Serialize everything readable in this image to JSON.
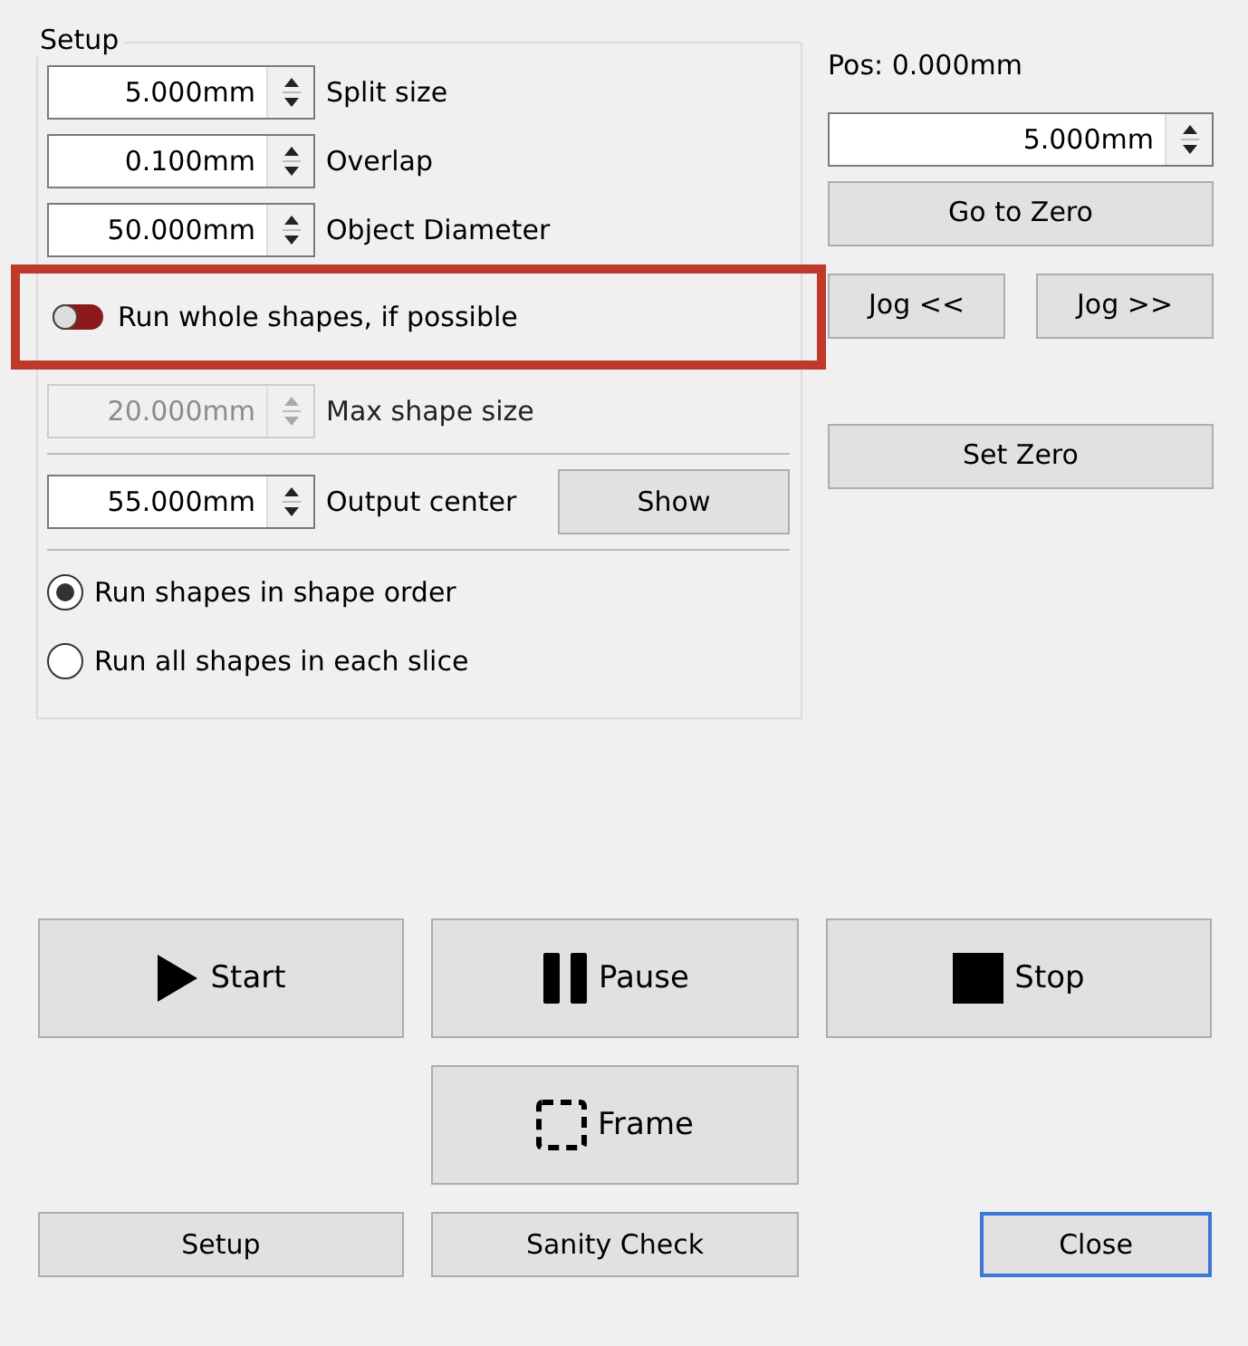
{
  "setup": {
    "title": "Setup",
    "rows": [
      {
        "kind": "spin",
        "value": "5.000mm",
        "label": "Split size",
        "disabled": false
      },
      {
        "kind": "spin",
        "value": "0.100mm",
        "label": "Overlap",
        "disabled": false
      },
      {
        "kind": "spin",
        "value": "50.000mm",
        "label": "Object Diameter",
        "disabled": false
      },
      {
        "kind": "toggle",
        "label": "Run whole shapes, if possible",
        "on": false,
        "highlighted": true
      },
      {
        "kind": "spin",
        "value": "20.000mm",
        "label": "Max shape size",
        "disabled": true
      },
      {
        "kind": "divider"
      },
      {
        "kind": "spin_button",
        "value": "55.000mm",
        "label": "Output center",
        "button": "Show",
        "disabled": false
      },
      {
        "kind": "divider"
      },
      {
        "kind": "radio",
        "label": "Run shapes in shape order",
        "selected": true
      },
      {
        "kind": "radio",
        "label": "Run all shapes in each slice",
        "selected": false
      }
    ]
  },
  "jog": {
    "position": "Pos: 0.000mm",
    "step": "5.000mm",
    "go_to_zero": "Go to Zero",
    "jog_buttons": [
      "Jog <<",
      "Jog >>"
    ],
    "set_zero": "Set Zero"
  },
  "run_buttons": [
    {
      "label": "Start",
      "kind": "play"
    },
    {
      "label": "Pause",
      "kind": "pause"
    },
    {
      "label": "Stop",
      "kind": "stop"
    }
  ],
  "frame_button": {
    "label": "Frame",
    "kind": "frame"
  },
  "footer_buttons": [
    {
      "label": "Setup",
      "default": false
    },
    {
      "label": "Sanity Check",
      "default": false
    },
    {
      "label": "Close",
      "default": true
    }
  ]
}
